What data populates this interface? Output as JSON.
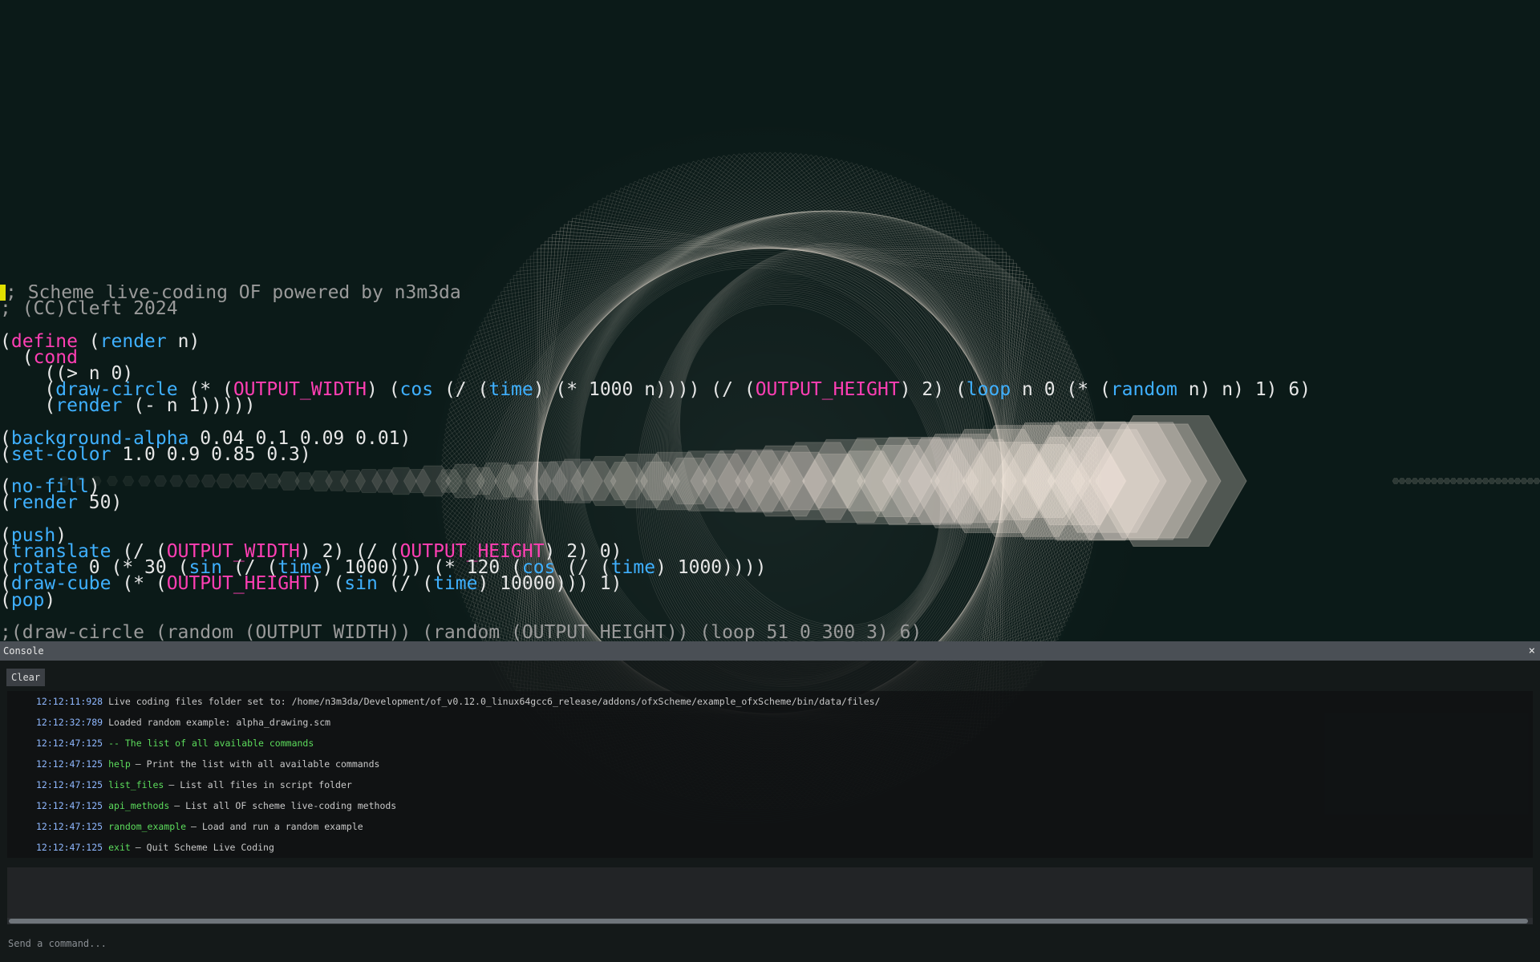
{
  "editor": {
    "lines": [
      [
        {
          "c": "tk-comment",
          "t": "; Scheme live-coding OF powered by n3m3da"
        }
      ],
      [
        {
          "c": "tk-comment",
          "t": "; (CC)Cleft 2024"
        }
      ],
      [],
      [
        {
          "c": "tk-text",
          "t": "("
        },
        {
          "c": "tk-special",
          "t": "define"
        },
        {
          "c": "tk-text",
          "t": " ("
        },
        {
          "c": "tk-func",
          "t": "render"
        },
        {
          "c": "tk-text",
          "t": " n)"
        }
      ],
      [
        {
          "c": "tk-text",
          "t": "  ("
        },
        {
          "c": "tk-special",
          "t": "cond"
        }
      ],
      [
        {
          "c": "tk-text",
          "t": "    ((> n 0)"
        }
      ],
      [
        {
          "c": "tk-text",
          "t": "    ("
        },
        {
          "c": "tk-func",
          "t": "draw-circle"
        },
        {
          "c": "tk-text",
          "t": " (* ("
        },
        {
          "c": "tk-const",
          "t": "OUTPUT_WIDTH"
        },
        {
          "c": "tk-text",
          "t": ") ("
        },
        {
          "c": "tk-func",
          "t": "cos"
        },
        {
          "c": "tk-text",
          "t": " (/ ("
        },
        {
          "c": "tk-func",
          "t": "time"
        },
        {
          "c": "tk-text",
          "t": ") (* 1000 n)))) (/ ("
        },
        {
          "c": "tk-const",
          "t": "OUTPUT_HEIGHT"
        },
        {
          "c": "tk-text",
          "t": ") 2) ("
        },
        {
          "c": "tk-func",
          "t": "loop"
        },
        {
          "c": "tk-text",
          "t": " n 0 (* ("
        },
        {
          "c": "tk-func",
          "t": "random"
        },
        {
          "c": "tk-text",
          "t": " n) n) 1) 6)"
        }
      ],
      [
        {
          "c": "tk-text",
          "t": "    ("
        },
        {
          "c": "tk-func",
          "t": "render"
        },
        {
          "c": "tk-text",
          "t": " (- n 1)))))"
        }
      ],
      [],
      [
        {
          "c": "tk-text",
          "t": "("
        },
        {
          "c": "tk-func",
          "t": "background-alpha"
        },
        {
          "c": "tk-text",
          "t": " 0.04 0.1 0.09 0.01)"
        }
      ],
      [
        {
          "c": "tk-text",
          "t": "("
        },
        {
          "c": "tk-func",
          "t": "set-color"
        },
        {
          "c": "tk-text",
          "t": " 1.0 0.9 0.85 0.3)"
        }
      ],
      [],
      [
        {
          "c": "tk-text",
          "t": "("
        },
        {
          "c": "tk-func",
          "t": "no-fill"
        },
        {
          "c": "tk-text",
          "t": ")"
        }
      ],
      [
        {
          "c": "tk-text",
          "t": "("
        },
        {
          "c": "tk-func",
          "t": "render"
        },
        {
          "c": "tk-text",
          "t": " 50)"
        }
      ],
      [],
      [
        {
          "c": "tk-text",
          "t": "("
        },
        {
          "c": "tk-func",
          "t": "push"
        },
        {
          "c": "tk-text",
          "t": ")"
        }
      ],
      [
        {
          "c": "tk-text",
          "t": "("
        },
        {
          "c": "tk-func",
          "t": "translate"
        },
        {
          "c": "tk-text",
          "t": " (/ ("
        },
        {
          "c": "tk-const",
          "t": "OUTPUT_WIDTH"
        },
        {
          "c": "tk-text",
          "t": ") 2) (/ ("
        },
        {
          "c": "tk-const",
          "t": "OUTPUT_HEIGHT"
        },
        {
          "c": "tk-text",
          "t": ") 2) 0)"
        }
      ],
      [
        {
          "c": "tk-text",
          "t": "("
        },
        {
          "c": "tk-func",
          "t": "rotate"
        },
        {
          "c": "tk-text",
          "t": " 0 (* 30 ("
        },
        {
          "c": "tk-func",
          "t": "sin"
        },
        {
          "c": "tk-text",
          "t": " (/ ("
        },
        {
          "c": "tk-func",
          "t": "time"
        },
        {
          "c": "tk-text",
          "t": ") 1000))) (* 120 ("
        },
        {
          "c": "tk-func",
          "t": "cos"
        },
        {
          "c": "tk-text",
          "t": " (/ ("
        },
        {
          "c": "tk-func",
          "t": "time"
        },
        {
          "c": "tk-text",
          "t": ") 1000))))"
        }
      ],
      [
        {
          "c": "tk-text",
          "t": "("
        },
        {
          "c": "tk-func",
          "t": "draw-cube"
        },
        {
          "c": "tk-text",
          "t": " (* ("
        },
        {
          "c": "tk-const",
          "t": "OUTPUT_HEIGHT"
        },
        {
          "c": "tk-text",
          "t": ") ("
        },
        {
          "c": "tk-func",
          "t": "sin"
        },
        {
          "c": "tk-text",
          "t": " (/ ("
        },
        {
          "c": "tk-func",
          "t": "time"
        },
        {
          "c": "tk-text",
          "t": ") 10000))) 1)"
        }
      ],
      [
        {
          "c": "tk-text",
          "t": "("
        },
        {
          "c": "tk-func",
          "t": "pop"
        },
        {
          "c": "tk-text",
          "t": ")"
        }
      ],
      [],
      [
        {
          "c": "tk-comment",
          "t": ";(draw-circle (random (OUTPUT_WIDTH)) (random (OUTPUT_HEIGHT)) (loop 51 0 300 3) 6)"
        }
      ]
    ]
  },
  "console": {
    "title": "Console",
    "close_label": "×",
    "clear_label": "Clear",
    "input_placeholder": "Send a command...",
    "log": [
      {
        "ts": "12:12:11:928",
        "cmd": "",
        "msg": "Live coding files folder set to: /home/n3m3da/Development/of_v0.12.0_linux64gcc6_release/addons/ofxScheme/example_ofxScheme/bin/data/files/",
        "green": false
      },
      {
        "ts": "12:12:32:789",
        "cmd": "",
        "msg": "Loaded random example: alpha_drawing.scm",
        "green": false
      },
      {
        "ts": "12:12:47:125",
        "cmd": "",
        "msg": "-- The list of all available commands",
        "green": true
      },
      {
        "ts": "12:12:47:125",
        "cmd": "help",
        "msg": "– Print the list with all available commands",
        "green": false
      },
      {
        "ts": "12:12:47:125",
        "cmd": "list_files",
        "msg": "– List all files in script folder",
        "green": false
      },
      {
        "ts": "12:12:47:125",
        "cmd": "api_methods",
        "msg": "– List all OF scheme live-coding methods",
        "green": false
      },
      {
        "ts": "12:12:47:125",
        "cmd": "random_example",
        "msg": "– Load and run a random example",
        "green": false
      },
      {
        "ts": "12:12:47:125",
        "cmd": "exit",
        "msg": "– Quit Scheme Live Coding",
        "green": false
      }
    ]
  },
  "colors": {
    "background": "#0b1a18",
    "comment": "#9a9a9a",
    "keyword": "#ff3fb4",
    "function": "#3fb0ff",
    "cursor": "#e0e000",
    "timestamp": "#8fb8ff",
    "command": "#5cdc5c"
  },
  "icons": {
    "close": "close-icon"
  }
}
